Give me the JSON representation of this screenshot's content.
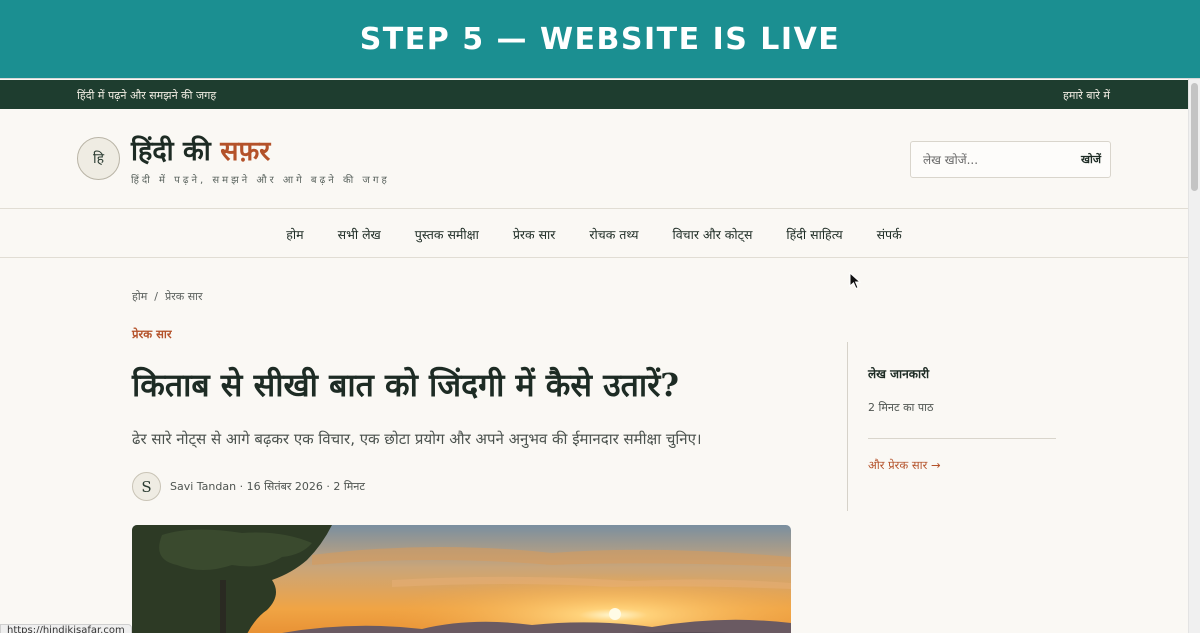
{
  "banner": {
    "title": "STEP 5 — WEBSITE IS LIVE"
  },
  "topbar": {
    "tagline": "हिंदी में पढ़ने और समझने की जगह",
    "about_link": "हमारे बारे में"
  },
  "header": {
    "logo_letter": "हि",
    "title_main": "हिंदी की ",
    "title_accent": "सफ़र",
    "tagline": "हिंदी में पढ़ने, समझने और आगे बढ़ने की जगह"
  },
  "search": {
    "placeholder": "लेख खोजें...",
    "button_label": "खोजें"
  },
  "nav": {
    "items": [
      {
        "label": "होम"
      },
      {
        "label": "सभी लेख"
      },
      {
        "label": "पुस्तक समीक्षा"
      },
      {
        "label": "प्रेरक सार"
      },
      {
        "label": "रोचक तथ्य"
      },
      {
        "label": "विचार और कोट्स"
      },
      {
        "label": "हिंदी साहित्य"
      },
      {
        "label": "संपर्क"
      }
    ]
  },
  "breadcrumb": {
    "home": "होम",
    "separator": "/",
    "current": "प्रेरक सार"
  },
  "article": {
    "category": "प्रेरक सार",
    "title": "किताब से सीखी बात को जिंदगी में कैसे उतारें?",
    "dek": "ढेर सारे नोट्स से आगे बढ़कर एक विचार, एक छोटा प्रयोग और अपने अनुभव की ईमानदार समीक्षा चुनिए।",
    "author_initial": "S",
    "meta": "Savi Tandan · 16 सितंबर 2026 · 2 मिनट"
  },
  "sidebar": {
    "title": "लेख जानकारी",
    "read_time": "2 मिनट का पाठ",
    "more_link": "और प्रेरक सार →"
  },
  "status_bar": {
    "url": "https://hindikisafar.com"
  },
  "colors": {
    "banner": "#1b8f91",
    "topbar": "#1e3d2f",
    "accent": "#b4522a",
    "background": "#faf8f4"
  }
}
